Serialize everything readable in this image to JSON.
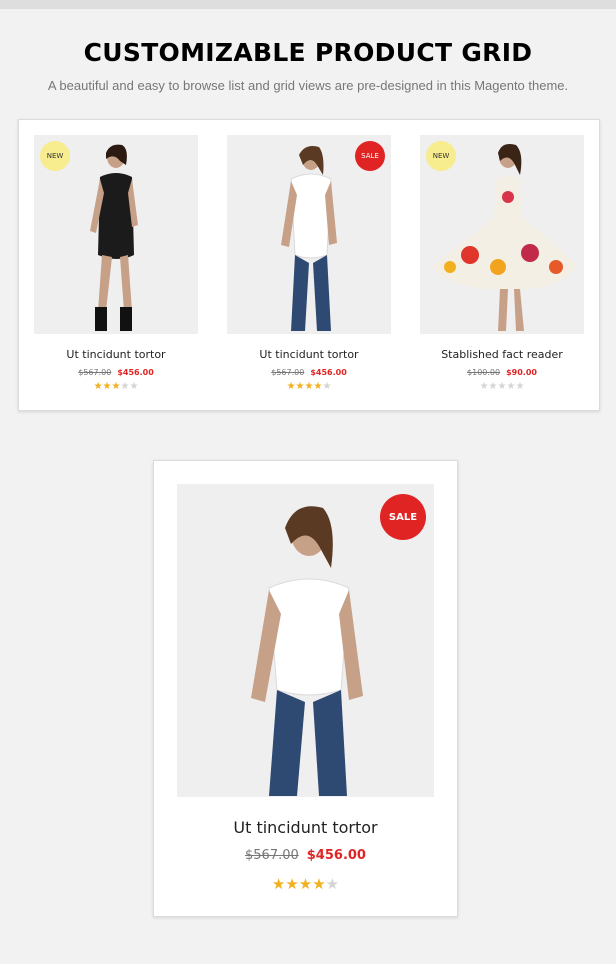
{
  "section": {
    "title": "CUSTOMIZABLE PRODUCT GRID",
    "subtitle": "A beautiful and easy to browse list and grid views are pre-designed in this Magento theme."
  },
  "grid_products": [
    {
      "badge": "NEW",
      "name": "Ut tincidunt tortor",
      "old_price": "$567.00",
      "price": "$456.00",
      "rating": 2.5
    },
    {
      "badge": "SALE",
      "name": "Ut tincidunt tortor",
      "old_price": "$567.00",
      "price": "$456.00",
      "rating": 4
    },
    {
      "badge": "NEW",
      "name": "Stablished fact reader",
      "old_price": "$100.00",
      "price": "$90.00",
      "rating": 0
    }
  ],
  "featured_product": {
    "badge": "SALE",
    "name": "Ut tincidunt tortor",
    "old_price": "$567.00",
    "price": "$456.00",
    "rating": 4
  },
  "colors": {
    "sale_badge": "#e02424",
    "new_badge": "#f7ec8e",
    "price": "#e02424",
    "star": "#f2b01e"
  }
}
